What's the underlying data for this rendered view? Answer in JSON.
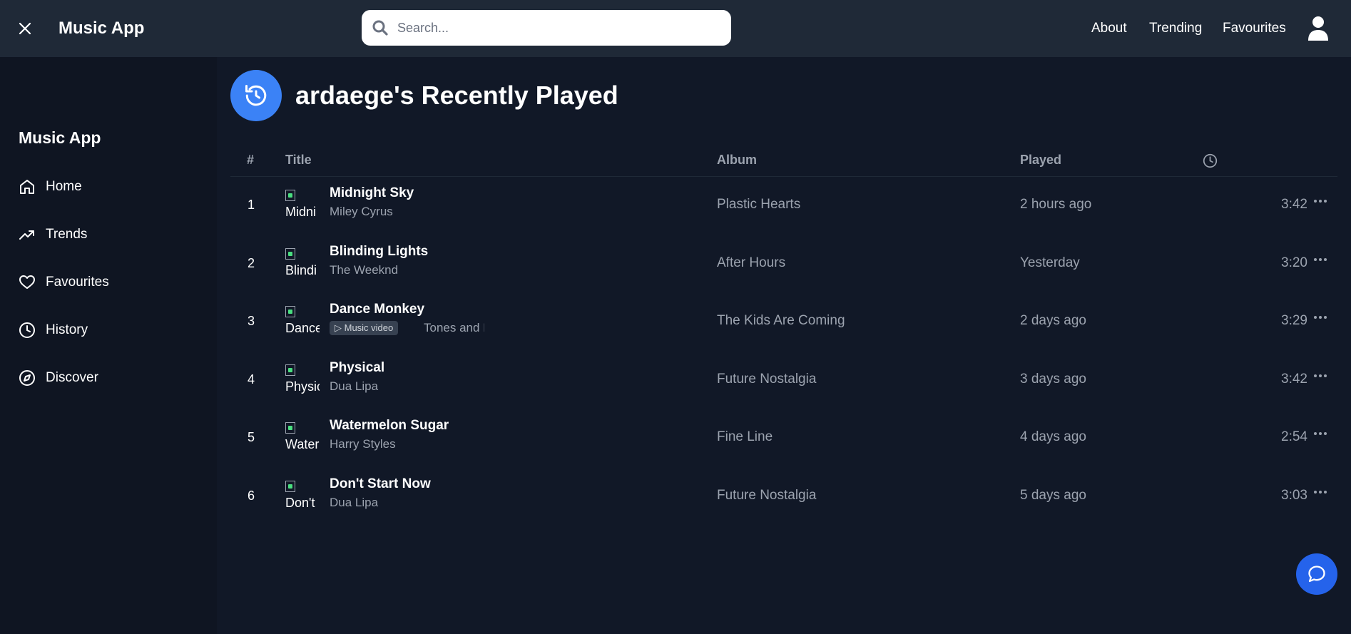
{
  "header": {
    "close_icon": "close-icon",
    "app_title": "Music App",
    "search": {
      "placeholder": "Search...",
      "value": "",
      "icon": "search-icon"
    },
    "nav": [
      "About",
      "Trending",
      "Favourites"
    ],
    "user_icon": "user-icon"
  },
  "sidebar": {
    "title": "Music App",
    "items": [
      {
        "label": "Home",
        "icon": "home-icon"
      },
      {
        "label": "Trends",
        "icon": "trending-up-icon"
      },
      {
        "label": "Favourites",
        "icon": "heart-icon"
      },
      {
        "label": "History",
        "icon": "clock-icon"
      },
      {
        "label": "Discover",
        "icon": "compass-icon"
      }
    ]
  },
  "main": {
    "title": "ardaege's Recently Played",
    "header_icon": "history-icon",
    "columns": {
      "num": "#",
      "title": "Title",
      "album": "Album",
      "played": "Played",
      "duration_icon": "clock-icon"
    },
    "tracks": [
      {
        "num": "1",
        "thumb_alt": "Midni",
        "title": "Midnight Sky",
        "artist": "Miley Cyrus",
        "album": "Plastic Hearts",
        "played": "2 hours ago",
        "duration": "3:42"
      },
      {
        "num": "2",
        "thumb_alt": "Blindi",
        "title": "Blinding Lights",
        "artist": "The Weeknd",
        "album": "After Hours",
        "played": "Yesterday",
        "duration": "3:20"
      },
      {
        "num": "3",
        "thumb_alt": "Dance",
        "title": "Dance Monkey",
        "badge": "▷ Music video",
        "artist": "Tones and I",
        "album": "The Kids Are Coming",
        "played": "2 days ago",
        "duration": "3:29"
      },
      {
        "num": "4",
        "thumb_alt": "Physic",
        "title": "Physical",
        "artist": "Dua Lipa",
        "album": "Future Nostalgia",
        "played": "3 days ago",
        "duration": "3:42"
      },
      {
        "num": "5",
        "thumb_alt": "Water",
        "title": "Watermelon Sugar",
        "artist": "Harry Styles",
        "album": "Fine Line",
        "played": "4 days ago",
        "duration": "2:54"
      },
      {
        "num": "6",
        "thumb_alt": "Don't",
        "title": "Don't Start Now",
        "artist": "Dua Lipa",
        "album": "Future Nostalgia",
        "played": "5 days ago",
        "duration": "3:03"
      }
    ],
    "row_menu_icon": "more-horizontal-icon"
  },
  "chat_button_icon": "chat-icon",
  "colors": {
    "topbar": "#1f2937",
    "sidebar": "#0f1522",
    "background": "#111827",
    "accent": "#3b82f6",
    "chat": "#2563eb",
    "muted_text": "#9ca3af"
  }
}
